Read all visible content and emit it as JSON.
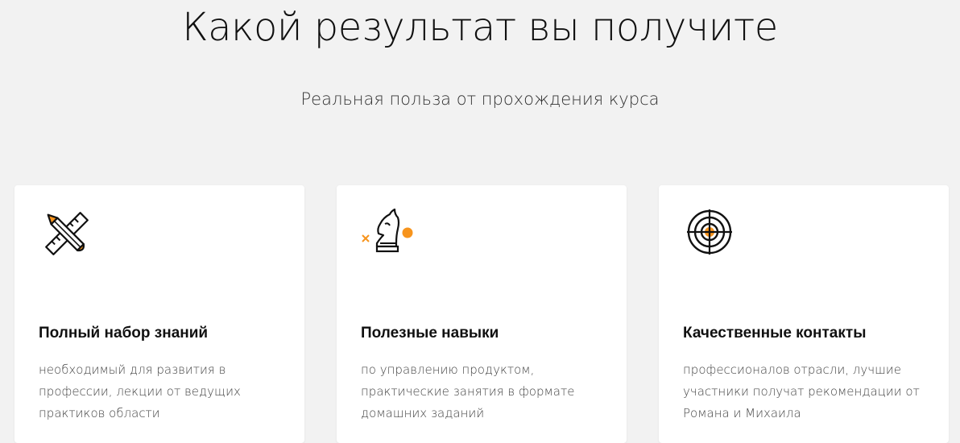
{
  "header": {
    "title": "Какой результат вы получите",
    "subtitle": "Реальная польза от прохождения курса"
  },
  "colors": {
    "background": "#f2f2f2",
    "card": "#ffffff",
    "accent": "#f7941d",
    "text": "#111111"
  },
  "cards": [
    {
      "icon": "pencil-ruler-icon",
      "title": "Полный набор знаний",
      "text": "необходимый для развития в профессии, лекции от ведущих практиков области"
    },
    {
      "icon": "chess-knight-icon",
      "title": "Полезные навыки",
      "text": "по управлению продуктом, практические занятия в формате домашних заданий"
    },
    {
      "icon": "target-icon",
      "title": "Качественные контакты",
      "text": "профессионалов отрасли, лучшие участники получат рекомендации от Романа и Михаила"
    }
  ]
}
